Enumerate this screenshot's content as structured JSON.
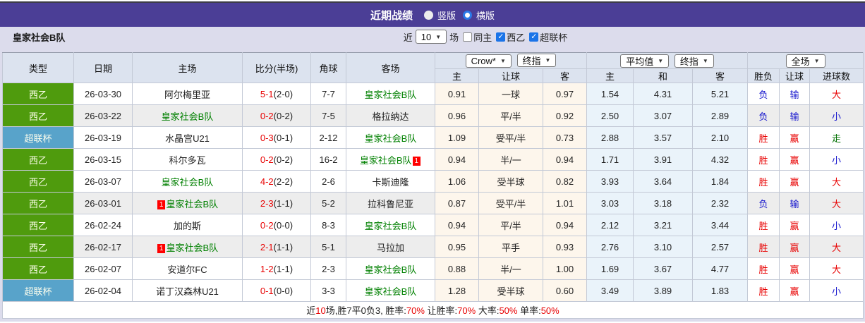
{
  "title_bar": {
    "title": "近期战绩",
    "vertical_label": "竖版",
    "horizontal_label": "横版"
  },
  "filter_bar": {
    "team_name": "皇家社会B队",
    "recent_label": "近",
    "match_count": "10",
    "unit_label": "场",
    "checkboxes": [
      {
        "label": "同主",
        "checked": false
      },
      {
        "label": "西乙",
        "checked": true
      },
      {
        "label": "超联杯",
        "checked": true
      }
    ]
  },
  "table": {
    "columns": {
      "type": "类型",
      "date": "日期",
      "home": "主场",
      "score": "比分(半场)",
      "corner": "角球",
      "away": "客场"
    },
    "dropdowns": {
      "bookmaker": "Crow*",
      "bookmaker_stage": "终指",
      "average": "平均值",
      "average_stage": "终指",
      "scope": "全场"
    },
    "subheaders": [
      "主",
      "让球",
      "客",
      "主",
      "和",
      "客",
      "胜负",
      "让球",
      "进球数"
    ],
    "rows": [
      {
        "league": "西乙",
        "league_class": "badge-green",
        "date": "26-03-30",
        "home": "阿尔梅里亚",
        "home_class": "",
        "home_card": "",
        "score": "5-1",
        "half": "(2-0)",
        "corner": "7-7",
        "away": "皇家社会B队",
        "away_class": "team-green",
        "away_card": "",
        "o1": "0.91",
        "o2": "一球",
        "o3": "0.97",
        "a1": "1.54",
        "a2": "4.31",
        "a3": "5.21",
        "r1": "负",
        "r1c": "c-blue",
        "r2": "输",
        "r2c": "c-blue",
        "r3": "大",
        "r3c": "c-red",
        "stripe": false
      },
      {
        "league": "西乙",
        "league_class": "badge-green",
        "date": "26-03-22",
        "home": "皇家社会B队",
        "home_class": "team-green",
        "home_card": "",
        "score": "0-2",
        "half": "(0-2)",
        "corner": "7-5",
        "away": "格拉纳达",
        "away_class": "",
        "away_card": "",
        "o1": "0.96",
        "o2": "平/半",
        "o3": "0.92",
        "a1": "2.50",
        "a2": "3.07",
        "a3": "2.89",
        "r1": "负",
        "r1c": "c-blue",
        "r2": "输",
        "r2c": "c-blue",
        "r3": "小",
        "r3c": "c-blue",
        "stripe": true
      },
      {
        "league": "超联杯",
        "league_class": "badge-blue",
        "date": "26-03-19",
        "home": "水晶宫U21",
        "home_class": "",
        "home_card": "",
        "score": "0-3",
        "half": "(0-1)",
        "corner": "2-12",
        "away": "皇家社会B队",
        "away_class": "team-green",
        "away_card": "",
        "o1": "1.09",
        "o2": "受平/半",
        "o3": "0.73",
        "a1": "2.88",
        "a2": "3.57",
        "a3": "2.10",
        "r1": "胜",
        "r1c": "c-red",
        "r2": "赢",
        "r2c": "c-red",
        "r3": "走",
        "r3c": "c-green",
        "stripe": false
      },
      {
        "league": "西乙",
        "league_class": "badge-green",
        "date": "26-03-15",
        "home": "科尔多瓦",
        "home_class": "",
        "home_card": "",
        "score": "0-2",
        "half": "(0-2)",
        "corner": "16-2",
        "away": "皇家社会B队",
        "away_class": "team-green",
        "away_card": "1",
        "o1": "0.94",
        "o2": "半/一",
        "o3": "0.94",
        "a1": "1.71",
        "a2": "3.91",
        "a3": "4.32",
        "r1": "胜",
        "r1c": "c-red",
        "r2": "赢",
        "r2c": "c-red",
        "r3": "小",
        "r3c": "c-blue",
        "stripe": false
      },
      {
        "league": "西乙",
        "league_class": "badge-green",
        "date": "26-03-07",
        "home": "皇家社会B队",
        "home_class": "team-green",
        "home_card": "",
        "score": "4-2",
        "half": "(2-2)",
        "corner": "2-6",
        "away": "卡斯迪隆",
        "away_class": "",
        "away_card": "",
        "o1": "1.06",
        "o2": "受半球",
        "o3": "0.82",
        "a1": "3.93",
        "a2": "3.64",
        "a3": "1.84",
        "r1": "胜",
        "r1c": "c-red",
        "r2": "赢",
        "r2c": "c-red",
        "r3": "大",
        "r3c": "c-red",
        "stripe": false
      },
      {
        "league": "西乙",
        "league_class": "badge-green",
        "date": "26-03-01",
        "home": "皇家社会B队",
        "home_class": "team-green",
        "home_card": "1",
        "score": "2-3",
        "half": "(1-1)",
        "corner": "5-2",
        "away": "拉科鲁尼亚",
        "away_class": "",
        "away_card": "",
        "o1": "0.87",
        "o2": "受平/半",
        "o3": "1.01",
        "a1": "3.03",
        "a2": "3.18",
        "a3": "2.32",
        "r1": "负",
        "r1c": "c-blue",
        "r2": "输",
        "r2c": "c-blue",
        "r3": "大",
        "r3c": "c-red",
        "stripe": true
      },
      {
        "league": "西乙",
        "league_class": "badge-green",
        "date": "26-02-24",
        "home": "加的斯",
        "home_class": "",
        "home_card": "",
        "score": "0-2",
        "half": "(0-0)",
        "corner": "8-3",
        "away": "皇家社会B队",
        "away_class": "team-green",
        "away_card": "",
        "o1": "0.94",
        "o2": "平/半",
        "o3": "0.94",
        "a1": "2.12",
        "a2": "3.21",
        "a3": "3.44",
        "r1": "胜",
        "r1c": "c-red",
        "r2": "赢",
        "r2c": "c-red",
        "r3": "小",
        "r3c": "c-blue",
        "stripe": false
      },
      {
        "league": "西乙",
        "league_class": "badge-green",
        "date": "26-02-17",
        "home": "皇家社会B队",
        "home_class": "team-green",
        "home_card": "1",
        "score": "2-1",
        "half": "(1-1)",
        "corner": "5-1",
        "away": "马拉加",
        "away_class": "",
        "away_card": "",
        "o1": "0.95",
        "o2": "平手",
        "o3": "0.93",
        "a1": "2.76",
        "a2": "3.10",
        "a3": "2.57",
        "r1": "胜",
        "r1c": "c-red",
        "r2": "赢",
        "r2c": "c-red",
        "r3": "大",
        "r3c": "c-red",
        "stripe": true
      },
      {
        "league": "西乙",
        "league_class": "badge-green",
        "date": "26-02-07",
        "home": "安道尔FC",
        "home_class": "",
        "home_card": "",
        "score": "1-2",
        "half": "(1-1)",
        "corner": "2-3",
        "away": "皇家社会B队",
        "away_class": "team-green",
        "away_card": "",
        "o1": "0.88",
        "o2": "半/一",
        "o3": "1.00",
        "a1": "1.69",
        "a2": "3.67",
        "a3": "4.77",
        "r1": "胜",
        "r1c": "c-red",
        "r2": "赢",
        "r2c": "c-red",
        "r3": "大",
        "r3c": "c-red",
        "stripe": false
      },
      {
        "league": "超联杯",
        "league_class": "badge-blue",
        "date": "26-02-04",
        "home": "诺丁汉森林U21",
        "home_class": "",
        "home_card": "",
        "score": "0-1",
        "half": "(0-0)",
        "corner": "3-3",
        "away": "皇家社会B队",
        "away_class": "team-green",
        "away_card": "",
        "o1": "1.28",
        "o2": "受半球",
        "o3": "0.60",
        "a1": "3.49",
        "a2": "3.89",
        "a3": "1.83",
        "r1": "胜",
        "r1c": "c-red",
        "r2": "赢",
        "r2c": "c-red",
        "r3": "小",
        "r3c": "c-blue",
        "stripe": false
      }
    ]
  },
  "footer": {
    "parts": [
      {
        "t": "近"
      },
      {
        "t": "10",
        "c": "c-red"
      },
      {
        "t": "场,胜7平0负3, 胜率:"
      },
      {
        "t": "70%",
        "c": "c-red"
      },
      {
        "t": " 让胜率:"
      },
      {
        "t": "70%",
        "c": "c-red"
      },
      {
        "t": " 大率:"
      },
      {
        "t": "50%",
        "c": "c-red"
      },
      {
        "t": " 单率:"
      },
      {
        "t": "50%",
        "c": "c-red"
      }
    ]
  },
  "colors": {
    "accent_purple": "#4b3e96",
    "league_green": "#4f9b0d",
    "league_blue": "#58a3ca",
    "team_green": "#008000",
    "win_red": "#e80000",
    "loss_blue": "#1515cd",
    "draw_green": "#007000",
    "handicap_bg": "#fdf6ec",
    "average_bg": "#eaf3fa"
  }
}
